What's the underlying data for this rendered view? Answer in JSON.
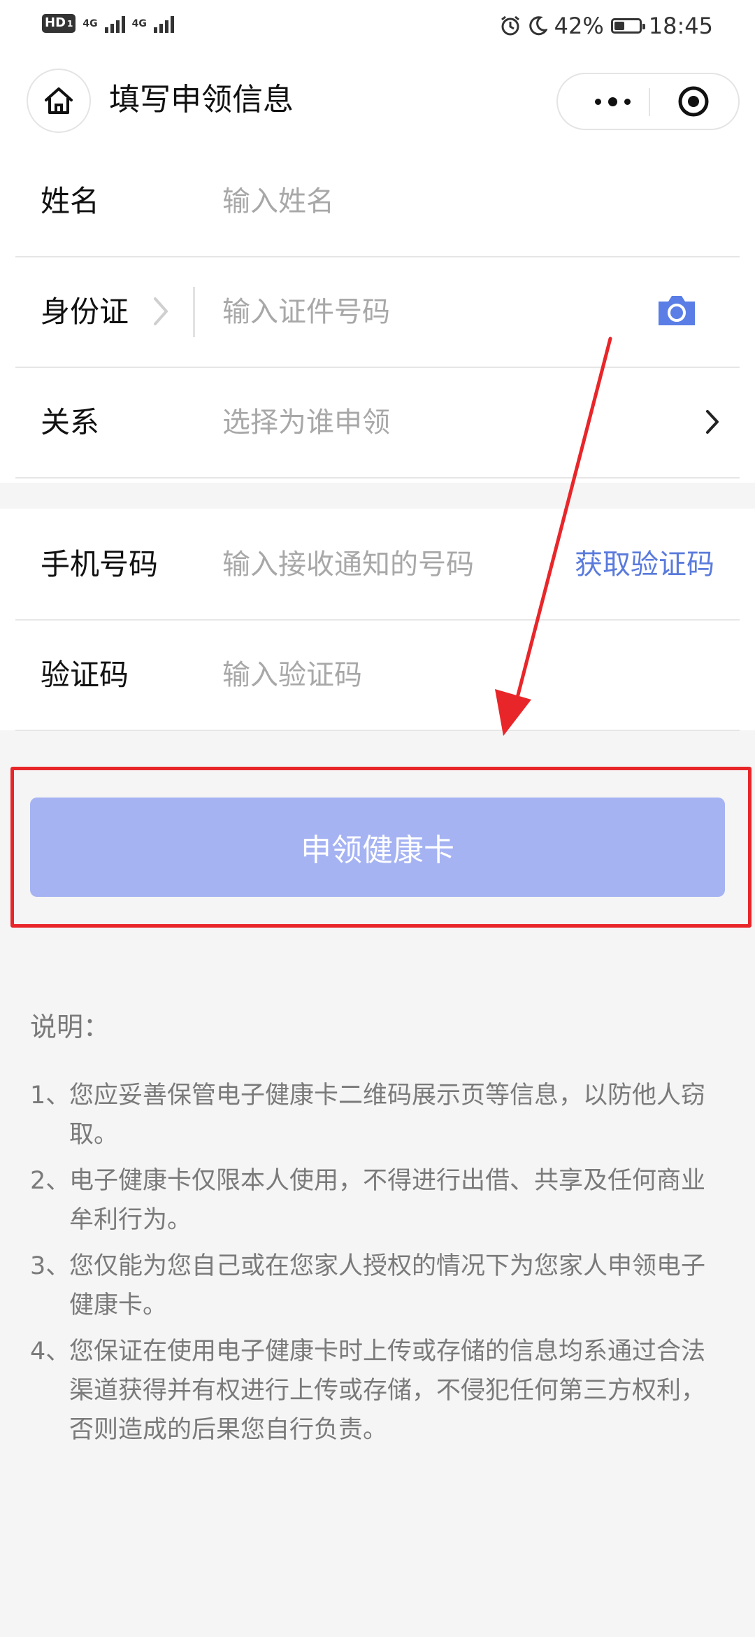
{
  "status_bar": {
    "hd": "HD",
    "sim1_sub": "1",
    "sim1_net": "4G",
    "sim2_net": "4G",
    "battery_level": 0.42,
    "battery_pct": "42%",
    "time": "18:45"
  },
  "nav": {
    "title": "填写申领信息"
  },
  "form": {
    "name": {
      "label": "姓名",
      "placeholder": "输入姓名"
    },
    "id_card": {
      "label": "身份证",
      "placeholder": "输入证件号码"
    },
    "relation": {
      "label": "关系",
      "placeholder": "选择为谁申领"
    },
    "phone": {
      "label": "手机号码",
      "placeholder": "输入接收通知的号码",
      "action": "获取验证码"
    },
    "code": {
      "label": "验证码",
      "placeholder": "输入验证码"
    }
  },
  "submit": {
    "label": "申领健康卡"
  },
  "notes": {
    "title": "说明：",
    "items": [
      {
        "num": "1、",
        "text": "您应妥善保管电子健康卡二维码展示页等信息，以防他人窃取。"
      },
      {
        "num": "2、",
        "text": "电子健康卡仅限本人使用，不得进行出借、共享及任何商业牟利行为。"
      },
      {
        "num": "3、",
        "text": "您仅能为您自己或在您家人授权的情况下为您家人申领电子健康卡。"
      },
      {
        "num": "4、",
        "text": "您保证在使用电子健康卡时上传或存储的信息均系通过合法渠道获得并有权进行上传或存储，不侵犯任何第三方权利，否则造成的后果您自行负责。"
      }
    ]
  },
  "colors": {
    "accent_link": "#5a7bdc",
    "button_bg": "#a5b3f3",
    "annotation_red": "#e8262a",
    "camera_blue": "#5a7ee6"
  }
}
